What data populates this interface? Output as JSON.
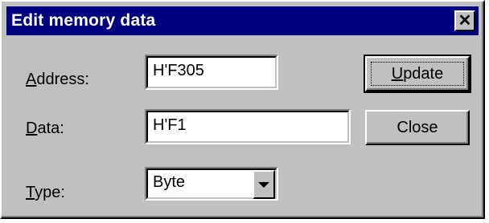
{
  "dialog": {
    "title": "Edit memory data",
    "close_glyph": "✕"
  },
  "address": {
    "label_accel": "A",
    "label_rest": "ddress:",
    "value": "H'F305"
  },
  "data": {
    "label_accel": "D",
    "label_rest": "ata:",
    "value": "H'F1"
  },
  "type": {
    "label_accel": "T",
    "label_rest": "ype:",
    "selected": "Byte"
  },
  "buttons": {
    "update_accel": "U",
    "update_rest": "pdate",
    "close": "Close"
  },
  "icons": {
    "title_close": "close-icon",
    "dropdown": "chevron-down-icon"
  }
}
